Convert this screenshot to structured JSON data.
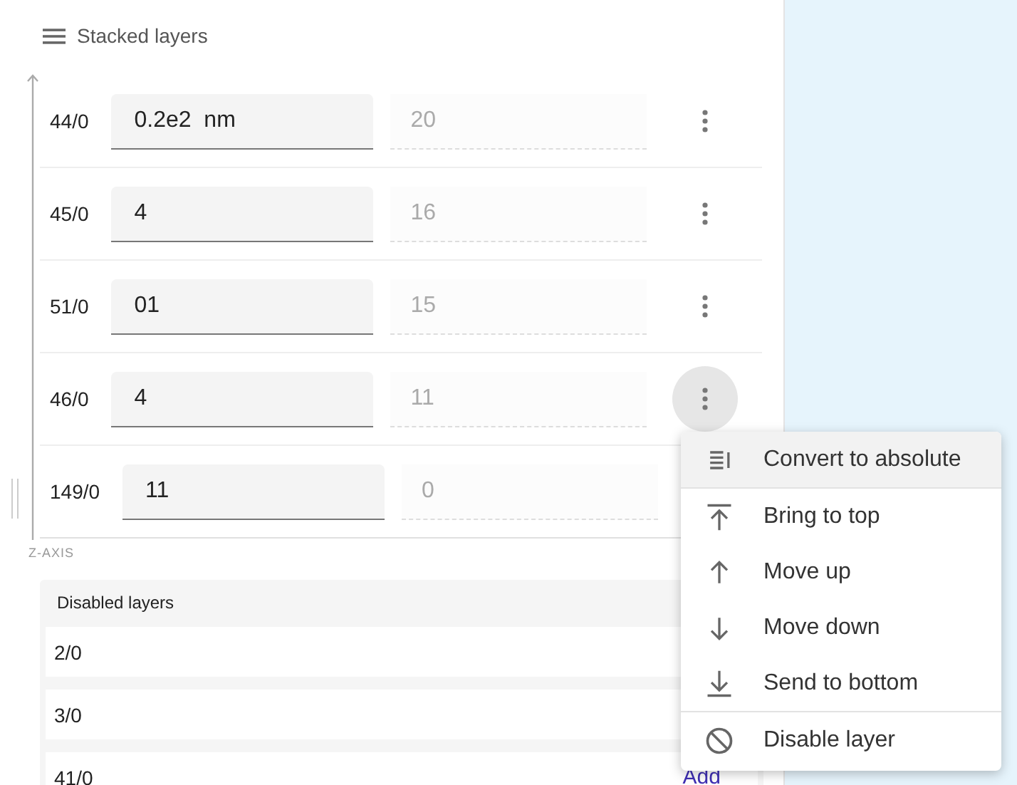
{
  "section_title": "Stacked layers",
  "layers": [
    {
      "label": "44/0",
      "value": "0.2e2  nm",
      "computed": "20",
      "menu_open": false
    },
    {
      "label": "45/0",
      "value": "4",
      "computed": "16",
      "menu_open": false
    },
    {
      "label": "51/0",
      "value": "01",
      "computed": "15",
      "menu_open": false
    },
    {
      "label": "46/0",
      "value": "4",
      "computed": "11",
      "menu_open": true
    },
    {
      "label": "149/0",
      "value": "11",
      "computed": "0"
    }
  ],
  "axis_label": "Z-AXIS",
  "disabled_layers": {
    "title": "Disabled layers",
    "rows": [
      {
        "label": "2/0"
      },
      {
        "label": "3/0"
      },
      {
        "label": "41/0",
        "action": "Add"
      }
    ]
  },
  "menu": [
    {
      "kind": "convert",
      "label": "Convert to absolute",
      "highlighted": true,
      "divider_after": true
    },
    {
      "kind": "top",
      "label": "Bring to top",
      "highlighted": false,
      "divider_after": false
    },
    {
      "kind": "up",
      "label": "Move up",
      "highlighted": false,
      "divider_after": false
    },
    {
      "kind": "down",
      "label": "Move down",
      "highlighted": false,
      "divider_after": false
    },
    {
      "kind": "bottom",
      "label": "Send to bottom",
      "highlighted": false,
      "divider_after": true
    },
    {
      "kind": "disable",
      "label": "Disable layer",
      "highlighted": false,
      "divider_after": false
    }
  ]
}
